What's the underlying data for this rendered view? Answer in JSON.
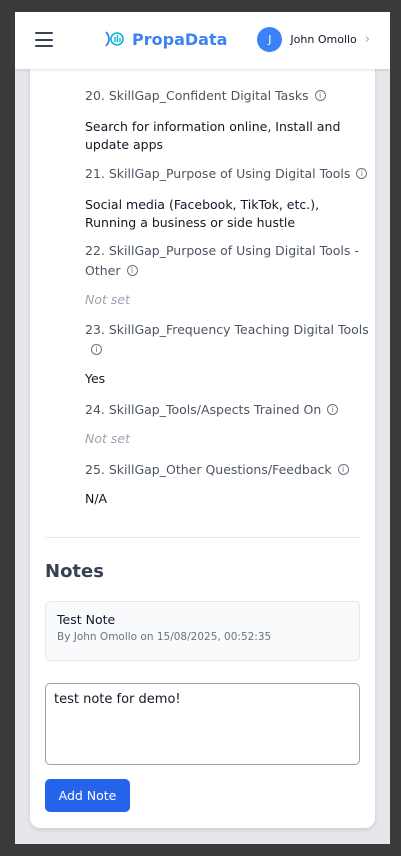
{
  "header": {
    "app_name": "PropaData",
    "user_initial": "J",
    "user_name": "John Omollo"
  },
  "fields": [
    {
      "label": "20. SkillGap_Confident Digital Tasks",
      "value": "Search for information online, Install and update apps",
      "not_set": false
    },
    {
      "label": "21. SkillGap_Purpose of Using Digital Tools",
      "value": "Social media (Facebook, TikTok, etc.), Running a business or side hustle",
      "not_set": false
    },
    {
      "label": "22. SkillGap_Purpose of Using Digital Tools - Other",
      "value": "Not set",
      "not_set": true
    },
    {
      "label": "23. SkillGap_Frequency Teaching Digital Tools",
      "value": "Yes",
      "not_set": false
    },
    {
      "label": "24. SkillGap_Tools/Aspects Trained On",
      "value": "Not set",
      "not_set": true
    },
    {
      "label": "25. SkillGap_Other Questions/Feedback",
      "value": "N/A",
      "not_set": false
    }
  ],
  "notes": {
    "title": "Notes",
    "items": [
      {
        "title": "Test Note",
        "meta": "By John Omollo on 15/08/2025, 00:52:35"
      }
    ],
    "input_value": "test note for demo!",
    "add_button_label": "Add Note"
  },
  "colors": {
    "accent": "#2563eb",
    "brand": "#3b82f6"
  }
}
